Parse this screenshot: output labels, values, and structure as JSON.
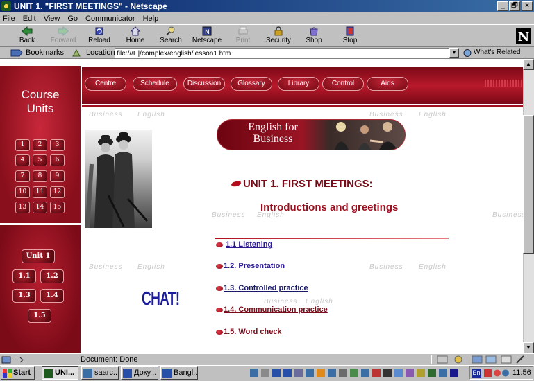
{
  "window": {
    "title": "UNIT 1. \"FIRST MEETINGS\" - Netscape",
    "controls": [
      "_",
      "🗗",
      "×"
    ]
  },
  "menu": [
    "File",
    "Edit",
    "View",
    "Go",
    "Communicator",
    "Help"
  ],
  "toolbar": [
    {
      "label": "Back",
      "icon": "back-icon",
      "disabled": false
    },
    {
      "label": "Forward",
      "icon": "forward-icon",
      "disabled": true
    },
    {
      "label": "Reload",
      "icon": "reload-icon",
      "disabled": false
    },
    {
      "label": "Home",
      "icon": "home-icon",
      "disabled": false
    },
    {
      "label": "Search",
      "icon": "search-icon",
      "disabled": false
    },
    {
      "label": "Netscape",
      "icon": "netscape-icon",
      "disabled": false
    },
    {
      "label": "Print",
      "icon": "print-icon",
      "disabled": true
    },
    {
      "label": "Security",
      "icon": "security-icon",
      "disabled": false
    },
    {
      "label": "Shop",
      "icon": "shop-icon",
      "disabled": false
    },
    {
      "label": "Stop",
      "icon": "stop-icon",
      "disabled": false
    }
  ],
  "logo_letter": "N",
  "location": {
    "bookmarks": "Bookmarks",
    "label": "Location:",
    "url": "file:///E|/complex/english/lesson1.htm",
    "whats_related": "What's Related"
  },
  "sidebar": {
    "title_line1": "Course",
    "title_line2": "Units",
    "unit_numbers": [
      "1",
      "2",
      "3",
      "4",
      "5",
      "6",
      "7",
      "8",
      "9",
      "10",
      "11",
      "12",
      "13",
      "14",
      "15"
    ],
    "unit_button": "Unit 1",
    "section_buttons": [
      "1.1",
      "1.2",
      "1.3",
      "1.4",
      "1.5"
    ]
  },
  "nav": [
    "Centre",
    "Schedule",
    "Discussion",
    "Glossary",
    "Library",
    "Control",
    "Aids"
  ],
  "watermark": {
    "word1": "Business",
    "word2": "English"
  },
  "banner": {
    "line1": "English for",
    "line2": "Business"
  },
  "main": {
    "unit_title": "UNIT 1. FIRST MEETINGS:",
    "subtitle": "Introductions and greetings",
    "lessons": [
      "1.1 Listening",
      "1.2. Presentation",
      "1.3. Controlled practice",
      "1.4. Communication practice",
      "1.5. Word check"
    ],
    "chat": "CHAT!"
  },
  "status": {
    "text": "Document: Done"
  },
  "taskbar": {
    "start": "Start",
    "tasks": [
      "UNI...",
      "saarc...",
      "Доку...",
      "Bangl..."
    ],
    "clock": "11:56",
    "lang": "En"
  },
  "colors": {
    "brand_red": "#9c0e1d",
    "title_bar": "#08246b",
    "link_blue": "#1a1a8c"
  }
}
